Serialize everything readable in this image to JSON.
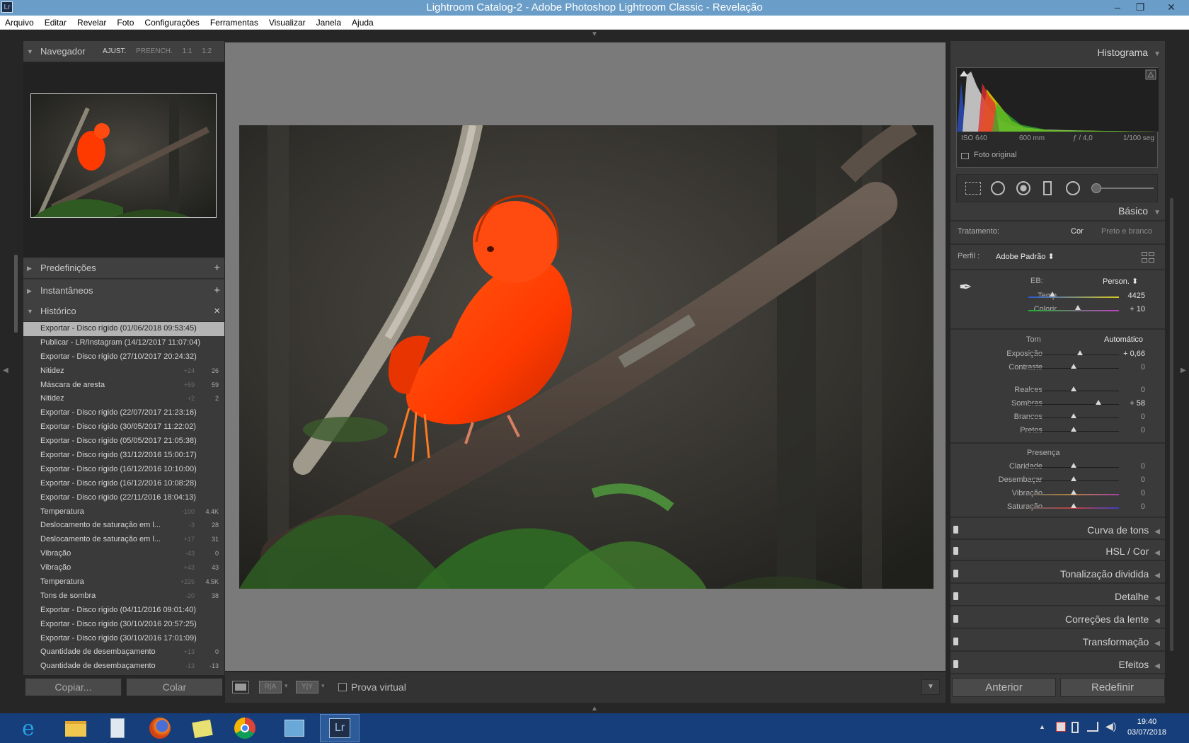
{
  "window": {
    "app_icon": "Lr",
    "title": "Lightroom Catalog-2 - Adobe Photoshop Lightroom Classic - Revelação",
    "controls": [
      "–",
      "❐",
      "✕"
    ]
  },
  "menu": [
    "Arquivo",
    "Editar",
    "Revelar",
    "Foto",
    "Configurações",
    "Ferramentas",
    "Visualizar",
    "Janela",
    "Ajuda"
  ],
  "navigator": {
    "title": "Navegador",
    "options": [
      "AJUST.",
      "PREENCH.",
      "1:1",
      "1:2"
    ]
  },
  "left_panels": {
    "presets": "Predefinições",
    "snapshots": "Instantâneos",
    "history": "Histórico",
    "add_glyph": "+",
    "close_glyph": "×"
  },
  "history": [
    {
      "name": "Exportar - Disco rígido (01/06/2018 09:53:45)",
      "a": "",
      "b": "",
      "selected": true
    },
    {
      "name": "Publicar - LR/Instagram (14/12/2017 11:07:04)",
      "a": "",
      "b": ""
    },
    {
      "name": "Exportar - Disco rígido (27/10/2017 20:24:32)",
      "a": "",
      "b": ""
    },
    {
      "name": "Nitidez",
      "a": "+24",
      "b": "26"
    },
    {
      "name": "Máscara de aresta",
      "a": "+59",
      "b": "59"
    },
    {
      "name": "Nitidez",
      "a": "+2",
      "b": "2"
    },
    {
      "name": "Exportar - Disco rígido (22/07/2017 21:23:16)",
      "a": "",
      "b": ""
    },
    {
      "name": "Exportar - Disco rígido (30/05/2017 11:22:02)",
      "a": "",
      "b": ""
    },
    {
      "name": "Exportar - Disco rígido (05/05/2017 21:05:38)",
      "a": "",
      "b": ""
    },
    {
      "name": "Exportar - Disco rígido (31/12/2016 15:00:17)",
      "a": "",
      "b": ""
    },
    {
      "name": "Exportar - Disco rígido (16/12/2016 10:10:00)",
      "a": "",
      "b": ""
    },
    {
      "name": "Exportar - Disco rígido (16/12/2016 10:08:28)",
      "a": "",
      "b": ""
    },
    {
      "name": "Exportar - Disco rígido (22/11/2016 18:04:13)",
      "a": "",
      "b": ""
    },
    {
      "name": "Temperatura",
      "a": "-100",
      "b": "4.4K"
    },
    {
      "name": "Deslocamento de saturação em l...",
      "a": "-3",
      "b": "28"
    },
    {
      "name": "Deslocamento de saturação em l...",
      "a": "+17",
      "b": "31"
    },
    {
      "name": "Vibração",
      "a": "-43",
      "b": "0"
    },
    {
      "name": "Vibração",
      "a": "+43",
      "b": "43"
    },
    {
      "name": "Temperatura",
      "a": "+225",
      "b": "4.5K"
    },
    {
      "name": "Tons de sombra",
      "a": "-20",
      "b": "38"
    },
    {
      "name": "Exportar - Disco rígido (04/11/2016 09:01:40)",
      "a": "",
      "b": ""
    },
    {
      "name": "Exportar - Disco rígido (30/10/2016 20:57:25)",
      "a": "",
      "b": ""
    },
    {
      "name": "Exportar - Disco rígido (30/10/2016 17:01:09)",
      "a": "",
      "b": ""
    },
    {
      "name": "Quantidade de desembaçamento",
      "a": "+13",
      "b": "0"
    },
    {
      "name": "Quantidade de desembaçamento",
      "a": "-13",
      "b": "-13"
    }
  ],
  "left_buttons": {
    "copy": "Copiar...",
    "paste": "Colar"
  },
  "toolbar": {
    "before_after": "R|A",
    "yy": "Y|Y",
    "soft_proof": "Prova virtual"
  },
  "histogram": {
    "title": "Histograma",
    "iso": "ISO 640",
    "focal": "600 mm",
    "aperture": "ƒ / 4,0",
    "shutter": "1/100 seg",
    "original_photo": "Foto original"
  },
  "basic": {
    "title": "Básico",
    "treatment_label": "Tratamento:",
    "treatment_color": "Cor",
    "treatment_bw": "Preto e branco",
    "profile_label": "Perfil :",
    "profile_value": "Adobe Padrão ⬍",
    "wb_label": "EB:",
    "wb_value": "Person. ⬍",
    "tone_label": "Tom",
    "auto_label": "Automático",
    "presence_label": "Presença",
    "sliders": [
      {
        "label": "Temp",
        "value": "4425",
        "pos": 0.27
      },
      {
        "label": "Colorir",
        "value": "+ 10",
        "pos": 0.54
      },
      {
        "label": "Exposição",
        "value": "+ 0,66",
        "pos": 0.57
      },
      {
        "label": "Contraste",
        "value": "0",
        "pos": 0.5
      },
      {
        "label": "Realces",
        "value": "0",
        "pos": 0.5
      },
      {
        "label": "Sombras",
        "value": "+ 58",
        "pos": 0.77
      },
      {
        "label": "Brancos",
        "value": "0",
        "pos": 0.5
      },
      {
        "label": "Pretos",
        "value": "0",
        "pos": 0.5
      },
      {
        "label": "Claridade",
        "value": "0",
        "pos": 0.5
      },
      {
        "label": "Desembaçar",
        "value": "0",
        "pos": 0.5
      },
      {
        "label": "Vibração",
        "value": "0",
        "pos": 0.5
      },
      {
        "label": "Saturação",
        "value": "0",
        "pos": 0.5
      }
    ]
  },
  "collapsed_panels": [
    "Curva de tons",
    "HSL / Cor",
    "Tonalização dividida",
    "Detalhe",
    "Correções da lente",
    "Transformação",
    "Efeitos"
  ],
  "right_buttons": {
    "previous": "Anterior",
    "reset": "Redefinir"
  },
  "taskbar": {
    "apps": [
      "internet-explorer-icon",
      "file-explorer-icon",
      "calculator-icon",
      "firefox-icon",
      "sticky-notes-icon",
      "chrome-icon",
      "control-panel-icon",
      "lightroom-icon"
    ],
    "lightroom_label": "Lr",
    "time": "19:40",
    "date": "03/07/2018"
  },
  "colors": {
    "photo_bird": "#ff3a00",
    "panel_bg": "#3a3a3a",
    "center_bg": "#7a7a7a",
    "taskbar": "#163e7a"
  }
}
